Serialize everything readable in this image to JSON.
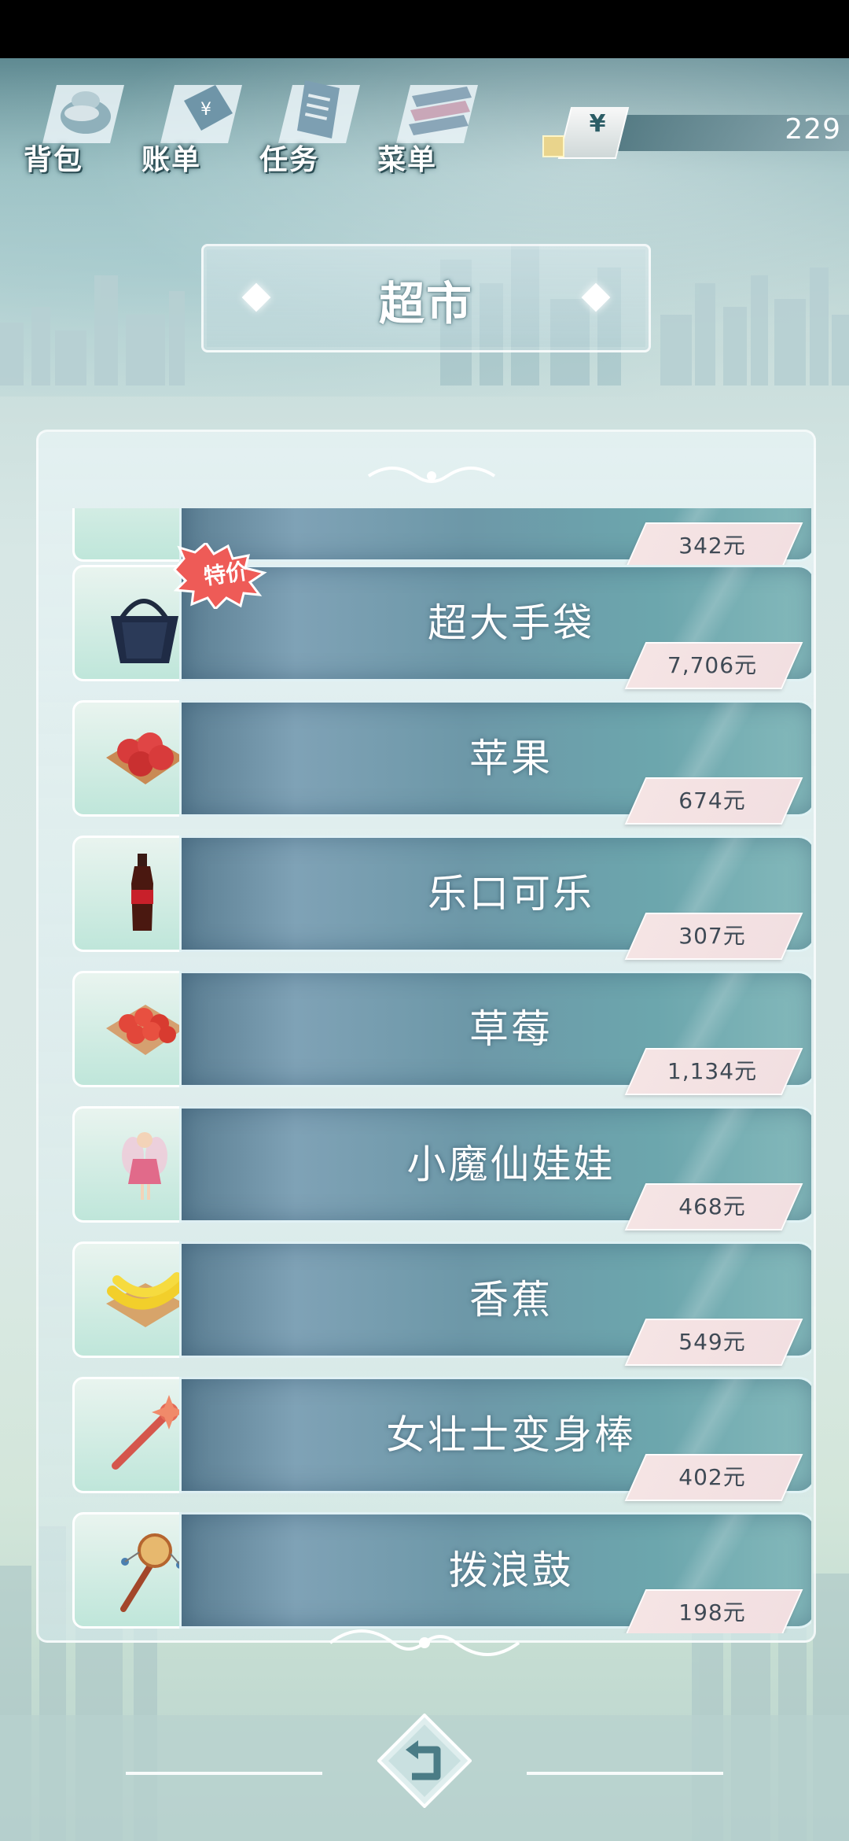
{
  "nav": [
    {
      "label": "背包",
      "icon": "backpack-icon"
    },
    {
      "label": "账单",
      "icon": "bill-icon"
    },
    {
      "label": "任务",
      "icon": "task-icon"
    },
    {
      "label": "菜单",
      "icon": "menu-icon"
    }
  ],
  "currency": {
    "symbol": "¥",
    "value": "229"
  },
  "title": "超市",
  "items": [
    {
      "name": "",
      "price": "342元",
      "thumb": "item-icon"
    },
    {
      "name": "超大手袋",
      "price": "7,706元",
      "thumb": "handbag-icon",
      "badge": "特价"
    },
    {
      "name": "苹果",
      "price": "674元",
      "thumb": "apple-icon"
    },
    {
      "name": "乐口可乐",
      "price": "307元",
      "thumb": "cola-icon"
    },
    {
      "name": "草莓",
      "price": "1,134元",
      "thumb": "strawberry-icon"
    },
    {
      "name": "小魔仙娃娃",
      "price": "468元",
      "thumb": "fairy-doll-icon"
    },
    {
      "name": "香蕉",
      "price": "549元",
      "thumb": "banana-icon"
    },
    {
      "name": "女壮士变身棒",
      "price": "402元",
      "thumb": "magic-wand-icon"
    },
    {
      "name": "拨浪鼓",
      "price": "198元",
      "thumb": "rattle-drum-icon"
    }
  ]
}
